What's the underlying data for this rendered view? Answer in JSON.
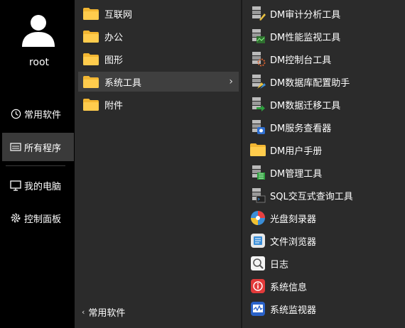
{
  "user": {
    "name": "root"
  },
  "sidebar": {
    "items": [
      {
        "label": "常用软件",
        "icon": "clock-icon"
      },
      {
        "label": "所有程序",
        "icon": "programs-icon",
        "active": true
      },
      {
        "label": "我的电脑",
        "icon": "monitor-icon"
      },
      {
        "label": "控制面板",
        "icon": "gear-icon"
      }
    ]
  },
  "categories": [
    {
      "label": "互联网"
    },
    {
      "label": "办公"
    },
    {
      "label": "图形"
    },
    {
      "label": "系统工具",
      "active": true,
      "has_submenu": true
    },
    {
      "label": "附件"
    }
  ],
  "back_label": "常用软件",
  "apps": [
    {
      "label": "DM审计分析工具",
      "icon": "dm-audit-icon"
    },
    {
      "label": "DM性能监视工具",
      "icon": "dm-monitor-icon"
    },
    {
      "label": "DM控制台工具",
      "icon": "dm-console-icon"
    },
    {
      "label": "DM数据库配置助手",
      "icon": "dm-config-icon"
    },
    {
      "label": "DM数据迁移工具",
      "icon": "dm-migrate-icon"
    },
    {
      "label": "DM服务查看器",
      "icon": "dm-service-icon"
    },
    {
      "label": "DM用户手册",
      "icon": "folder-icon"
    },
    {
      "label": "DM管理工具",
      "icon": "dm-manager-icon"
    },
    {
      "label": "SQL交互式查询工具",
      "icon": "dm-sql-icon"
    },
    {
      "label": "光盘刻录器",
      "icon": "disc-burner-icon"
    },
    {
      "label": "文件浏览器",
      "icon": "file-browser-icon"
    },
    {
      "label": "日志",
      "icon": "log-icon"
    },
    {
      "label": "系统信息",
      "icon": "system-info-icon"
    },
    {
      "label": "系统监视器",
      "icon": "system-monitor-icon"
    }
  ]
}
